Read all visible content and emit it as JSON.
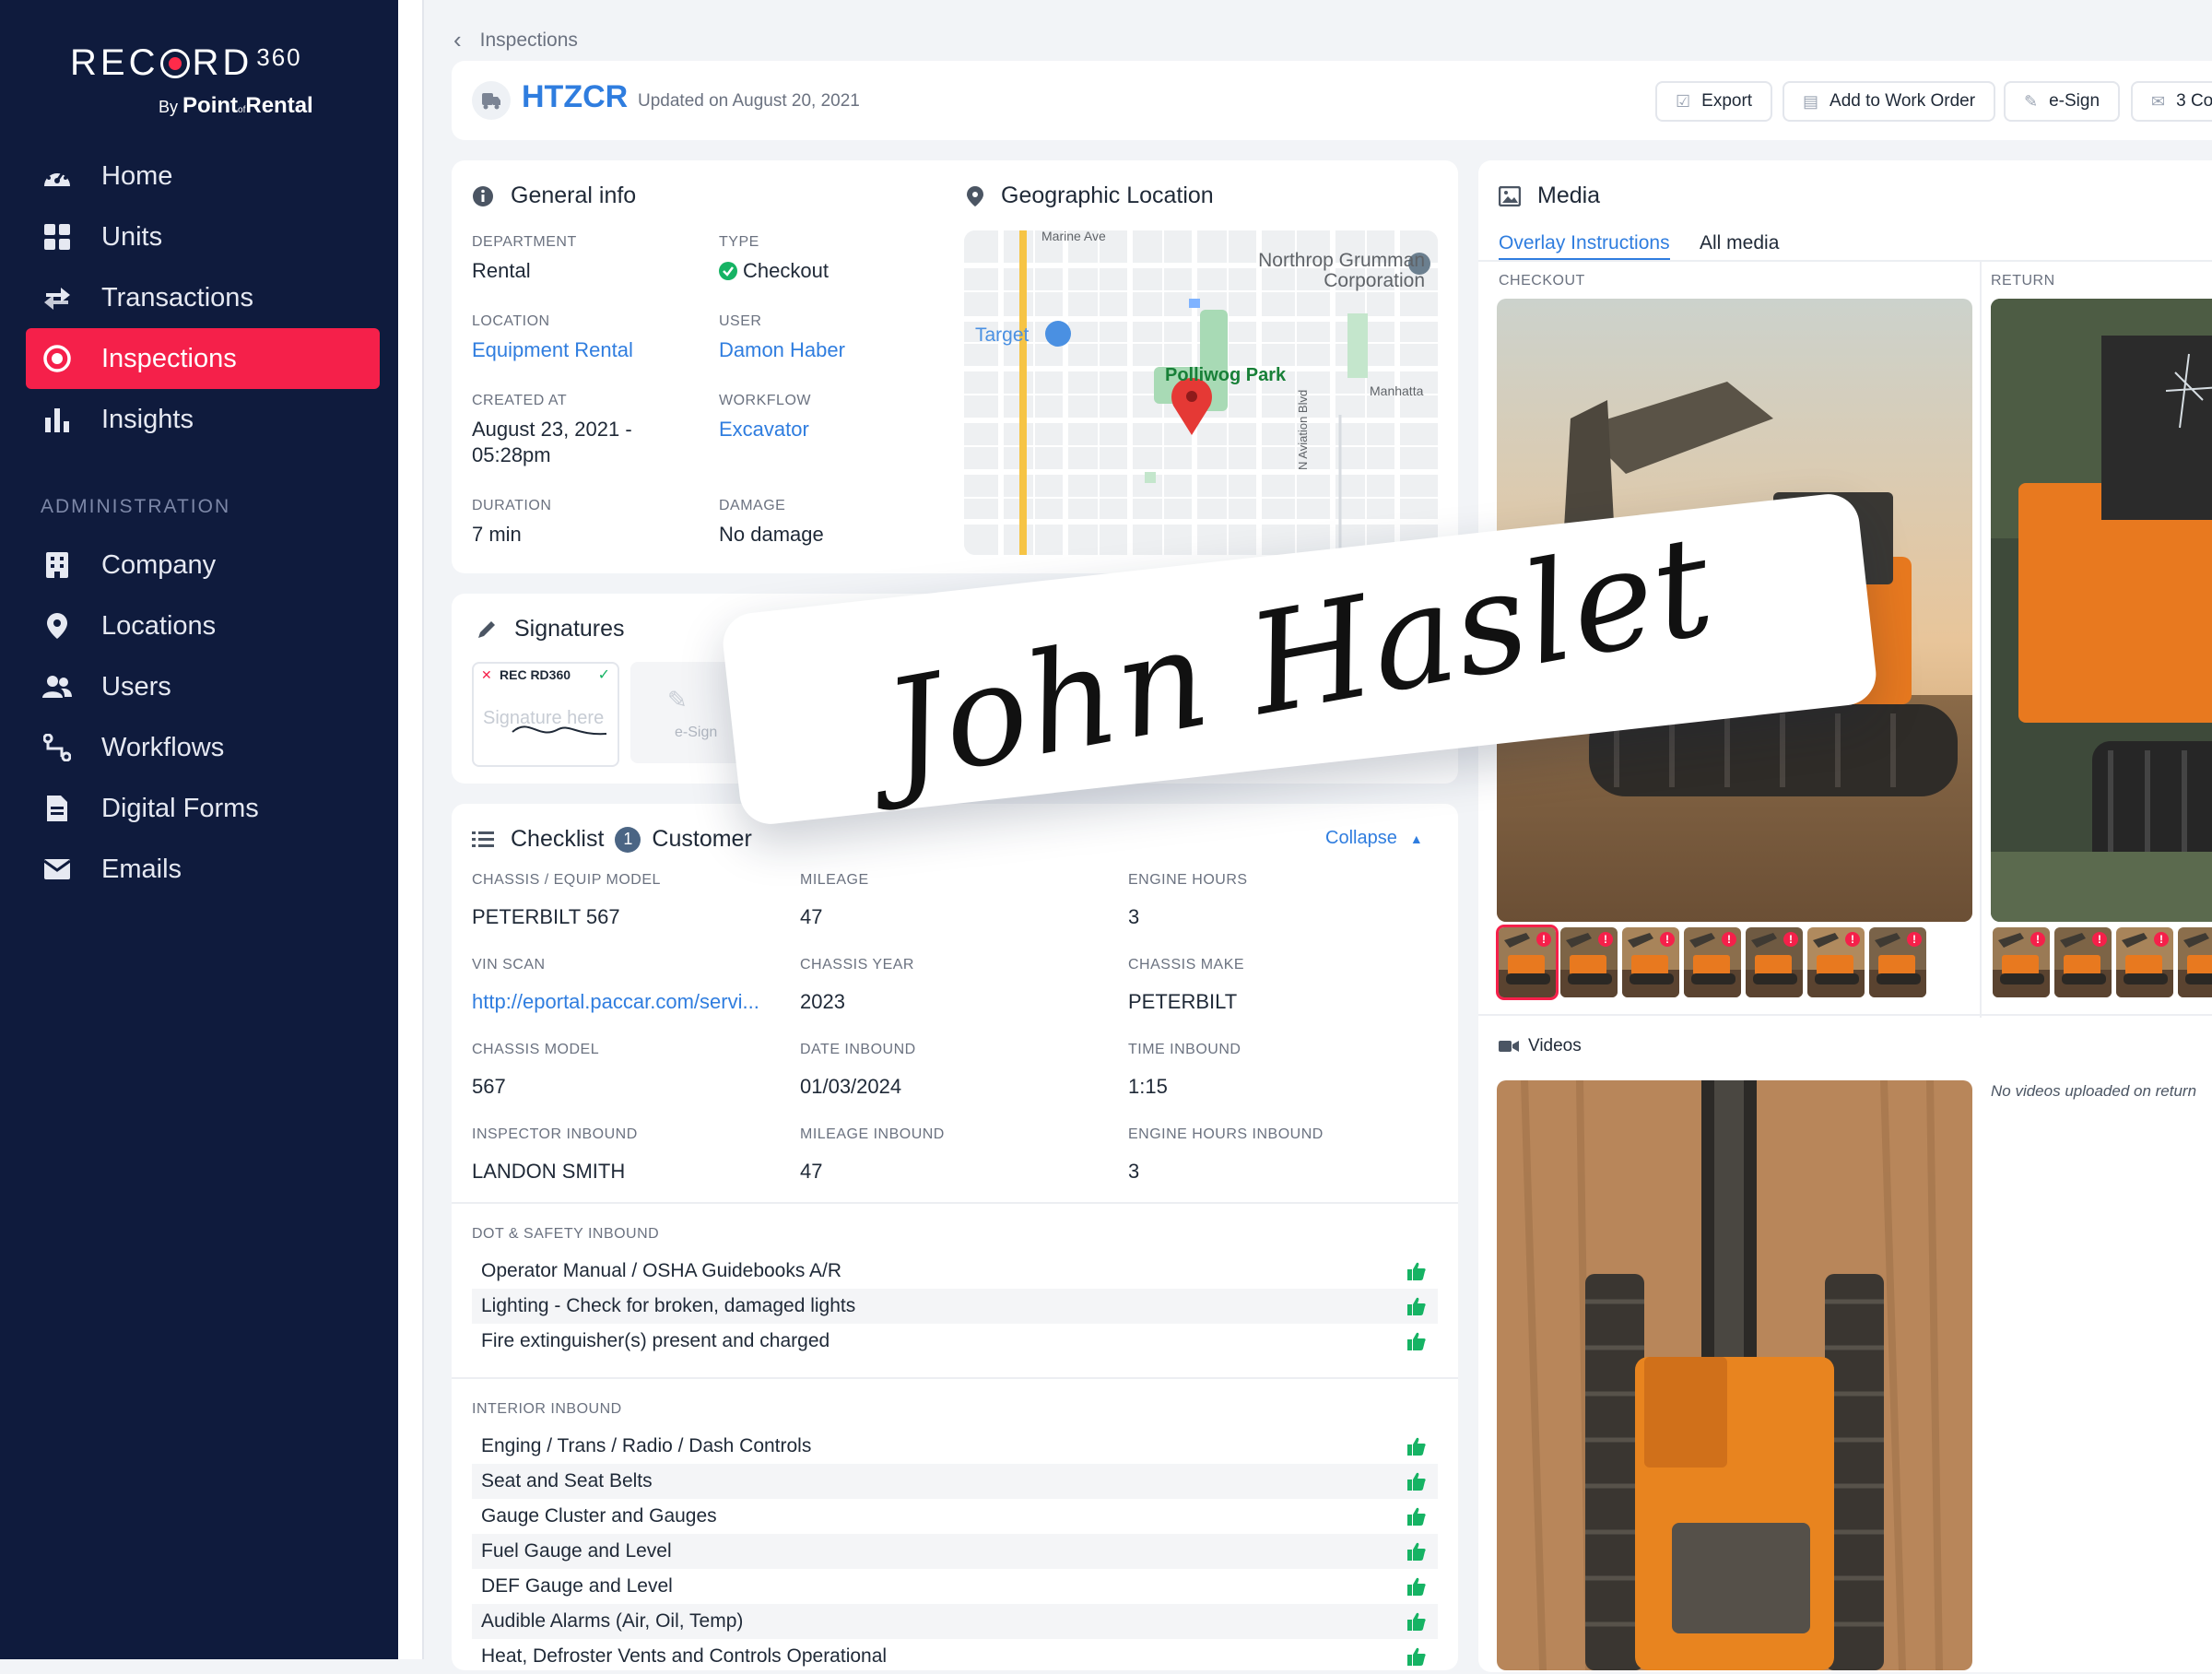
{
  "brand": {
    "name_pre": "REC",
    "name_post": "RD",
    "version": "360",
    "by": "By",
    "company_a": "Point",
    "company_of": "of",
    "company_b": "Rental"
  },
  "nav": {
    "items": [
      {
        "label": "Home",
        "icon": "dashboard-icon"
      },
      {
        "label": "Units",
        "icon": "grid-icon"
      },
      {
        "label": "Transactions",
        "icon": "transactions-icon"
      },
      {
        "label": "Inspections",
        "icon": "target-icon",
        "active": true
      },
      {
        "label": "Insights",
        "icon": "bar-chart-icon"
      }
    ],
    "admin_heading": "ADMINISTRATION",
    "admin_items": [
      {
        "label": "Company",
        "icon": "building-icon"
      },
      {
        "label": "Locations",
        "icon": "pin-icon"
      },
      {
        "label": "Users",
        "icon": "users-icon"
      },
      {
        "label": "Workflows",
        "icon": "workflow-icon"
      },
      {
        "label": "Digital Forms",
        "icon": "form-icon"
      },
      {
        "label": "Emails",
        "icon": "mail-icon"
      }
    ]
  },
  "breadcrumb": {
    "label": "Inspections"
  },
  "header": {
    "unit_id": "HTZCR",
    "updated": "Updated on August 20, 2021",
    "buttons": {
      "export": "Export",
      "work_order": "Add to Work Order",
      "esign": "e-Sign",
      "comments": "3 Co"
    }
  },
  "general_info": {
    "title": "General info",
    "department_label": "DEPARTMENT",
    "department": "Rental",
    "type_label": "TYPE",
    "type": "Checkout",
    "location_label": "LOCATION",
    "location": "Equipment Rental",
    "user_label": "USER",
    "user": "Damon Haber",
    "created_label": "CREATED AT",
    "created_line1": "August 23, 2021 -",
    "created_line2": "05:28pm",
    "workflow_label": "WORKFLOW",
    "workflow": "Excavator",
    "duration_label": "DURATION",
    "duration": "7 min",
    "damage_label": "DAMAGE",
    "damage": "No damage"
  },
  "geo": {
    "title": "Geographic Location",
    "street_top": "Marine Ave",
    "poi_1": "Northrop Grumman",
    "poi_1b": "Corporation",
    "poi_2": "Target",
    "poi_3": "Polliwog Park",
    "poi_4": "Manhatta",
    "street_side": "N Aviation Blvd"
  },
  "signatures": {
    "title": "Signatures",
    "thumb_brand": "REC RD360",
    "thumb_placeholder": "Signature here",
    "add_label": "e-Sign",
    "overlay_name": "John Haslet"
  },
  "checklist": {
    "title": "Checklist",
    "count": "1",
    "subtitle": "Customer",
    "collapse": "Collapse",
    "fields": [
      {
        "label": "CHASSIS / EQUIP MODEL",
        "value": "PETERBILT 567"
      },
      {
        "label": "MILEAGE",
        "value": "47"
      },
      {
        "label": "ENGINE HOURS",
        "value": "3"
      },
      {
        "label": "VIN SCAN",
        "value": "http://eportal.paccar.com/servi...",
        "link": true
      },
      {
        "label": "CHASSIS YEAR",
        "value": "2023"
      },
      {
        "label": "CHASSIS MAKE",
        "value": "PETERBILT"
      },
      {
        "label": "CHASSIS MODEL",
        "value": "567"
      },
      {
        "label": "DATE INBOUND",
        "value": "01/03/2024"
      },
      {
        "label": "TIME INBOUND",
        "value": "1:15"
      },
      {
        "label": "INSPECTOR INBOUND",
        "value": "LANDON SMITH"
      },
      {
        "label": "MILEAGE INBOUND",
        "value": "47"
      },
      {
        "label": "ENGINE HOURS INBOUND",
        "value": "3"
      }
    ],
    "dot_heading": "DOT & SAFETY INBOUND",
    "dot_items": [
      "Operator Manual / OSHA Guidebooks A/R",
      "Lighting - Check for broken, damaged lights",
      "Fire extinguisher(s) present and charged"
    ],
    "interior_heading": "INTERIOR INBOUND",
    "interior_items": [
      "Enging / Trans / Radio / Dash Controls",
      "Seat and Seat Belts",
      "Gauge Cluster and Gauges",
      "Fuel Gauge and Level",
      "DEF Gauge and Level",
      "Audible Alarms (Air, Oil, Temp)",
      "Heat, Defroster Vents and Controls Operational"
    ],
    "pass_color": "#16b364"
  },
  "media": {
    "title": "Media",
    "tab_overlay": "Overlay Instructions",
    "tab_all": "All media",
    "checkout_label": "CHECKOUT",
    "return_label": "RETURN",
    "videos_title": "Videos",
    "no_videos": "No videos uploaded on return"
  },
  "colors": {
    "accent": "#2f7ddf",
    "active_nav": "#f5204a",
    "sidebar": "#0f1b3d"
  }
}
